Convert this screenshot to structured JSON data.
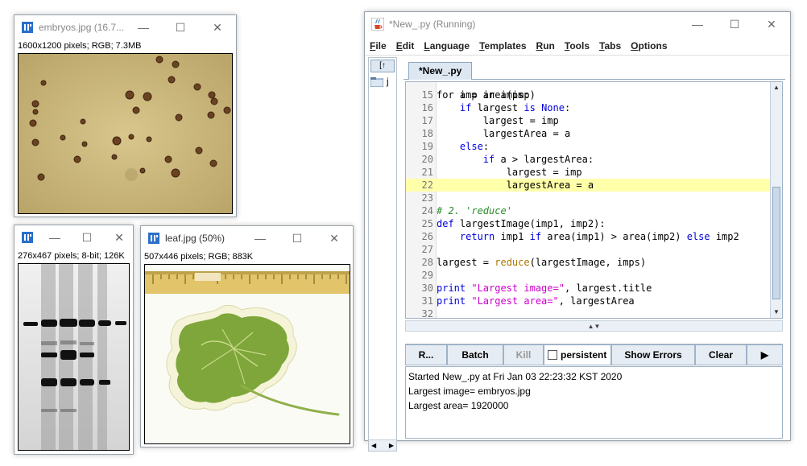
{
  "embryos_window": {
    "title": "embryos.jpg (16.7...",
    "info": "1600x1200 pixels; RGB; 7.3MB"
  },
  "blot_window": {
    "title": "",
    "info": "276x467 pixels; 8-bit; 126K"
  },
  "leaf_window": {
    "title": "leaf.jpg (50%)",
    "info": "507x446 pixels; RGB; 883K"
  },
  "editor_window": {
    "title": "*New_.py (Running)",
    "menu": [
      {
        "label": "File",
        "ul": "F",
        "rest": "ile"
      },
      {
        "label": "Edit",
        "ul": "E",
        "rest": "dit"
      },
      {
        "label": "Language",
        "ul": "L",
        "rest": "anguage"
      },
      {
        "label": "Templates",
        "ul": "T",
        "rest": "emplates"
      },
      {
        "label": "Run",
        "ul": "R",
        "rest": "un"
      },
      {
        "label": "Tools",
        "ul": "T",
        "rest": "ools"
      },
      {
        "label": "Tabs",
        "ul": "T",
        "rest": "abs"
      },
      {
        "label": "Options",
        "ul": "O",
        "rest": "ptions"
      }
    ],
    "tab_label": "*New_.py",
    "left_pane_label": "j",
    "code_lines": [
      {
        "n": "15",
        "text": "    a = area(imp)",
        "hl": false
      },
      {
        "n": "16",
        "text": "    if largest is None:",
        "hl": false
      },
      {
        "n": "17",
        "text": "        largest = imp",
        "hl": false
      },
      {
        "n": "18",
        "text": "        largestArea = a",
        "hl": false
      },
      {
        "n": "19",
        "text": "    else:",
        "hl": false
      },
      {
        "n": "20",
        "text": "        if a > largestArea:",
        "hl": false
      },
      {
        "n": "21",
        "text": "            largest = imp",
        "hl": false
      },
      {
        "n": "22",
        "text": "            largestArea = a",
        "hl": true
      },
      {
        "n": "23",
        "text": "",
        "hl": false
      },
      {
        "n": "24",
        "text": "# 2. 'reduce'",
        "hl": false
      },
      {
        "n": "25",
        "text": "def largestImage(imp1, imp2):",
        "hl": false
      },
      {
        "n": "26",
        "text": "    return imp1 if area(imp1) > area(imp2) else imp2",
        "hl": false
      },
      {
        "n": "27",
        "text": "",
        "hl": false
      },
      {
        "n": "28",
        "text": "largest = reduce(largestImage, imps)",
        "hl": false
      },
      {
        "n": "29",
        "text": "",
        "hl": false
      },
      {
        "n": "30",
        "text": "print \"Largest image=\", largest.title",
        "hl": false
      },
      {
        "n": "31",
        "text": "print \"Largest area=\", largestArea",
        "hl": false
      },
      {
        "n": "32",
        "text": "",
        "hl": false
      }
    ],
    "partial_top_line": "for imp in imps:",
    "buttons": {
      "run": "R...",
      "batch": "Batch",
      "kill": "Kill",
      "persistent": "persistent",
      "show_errors": "Show Errors",
      "clear": "Clear",
      "more": "▶"
    },
    "output": [
      "Started New_.py at Fri Jan 03 22:23:32 KST 2020",
      "Largest image= embryos.jpg",
      "Largest area= 1920000"
    ]
  }
}
